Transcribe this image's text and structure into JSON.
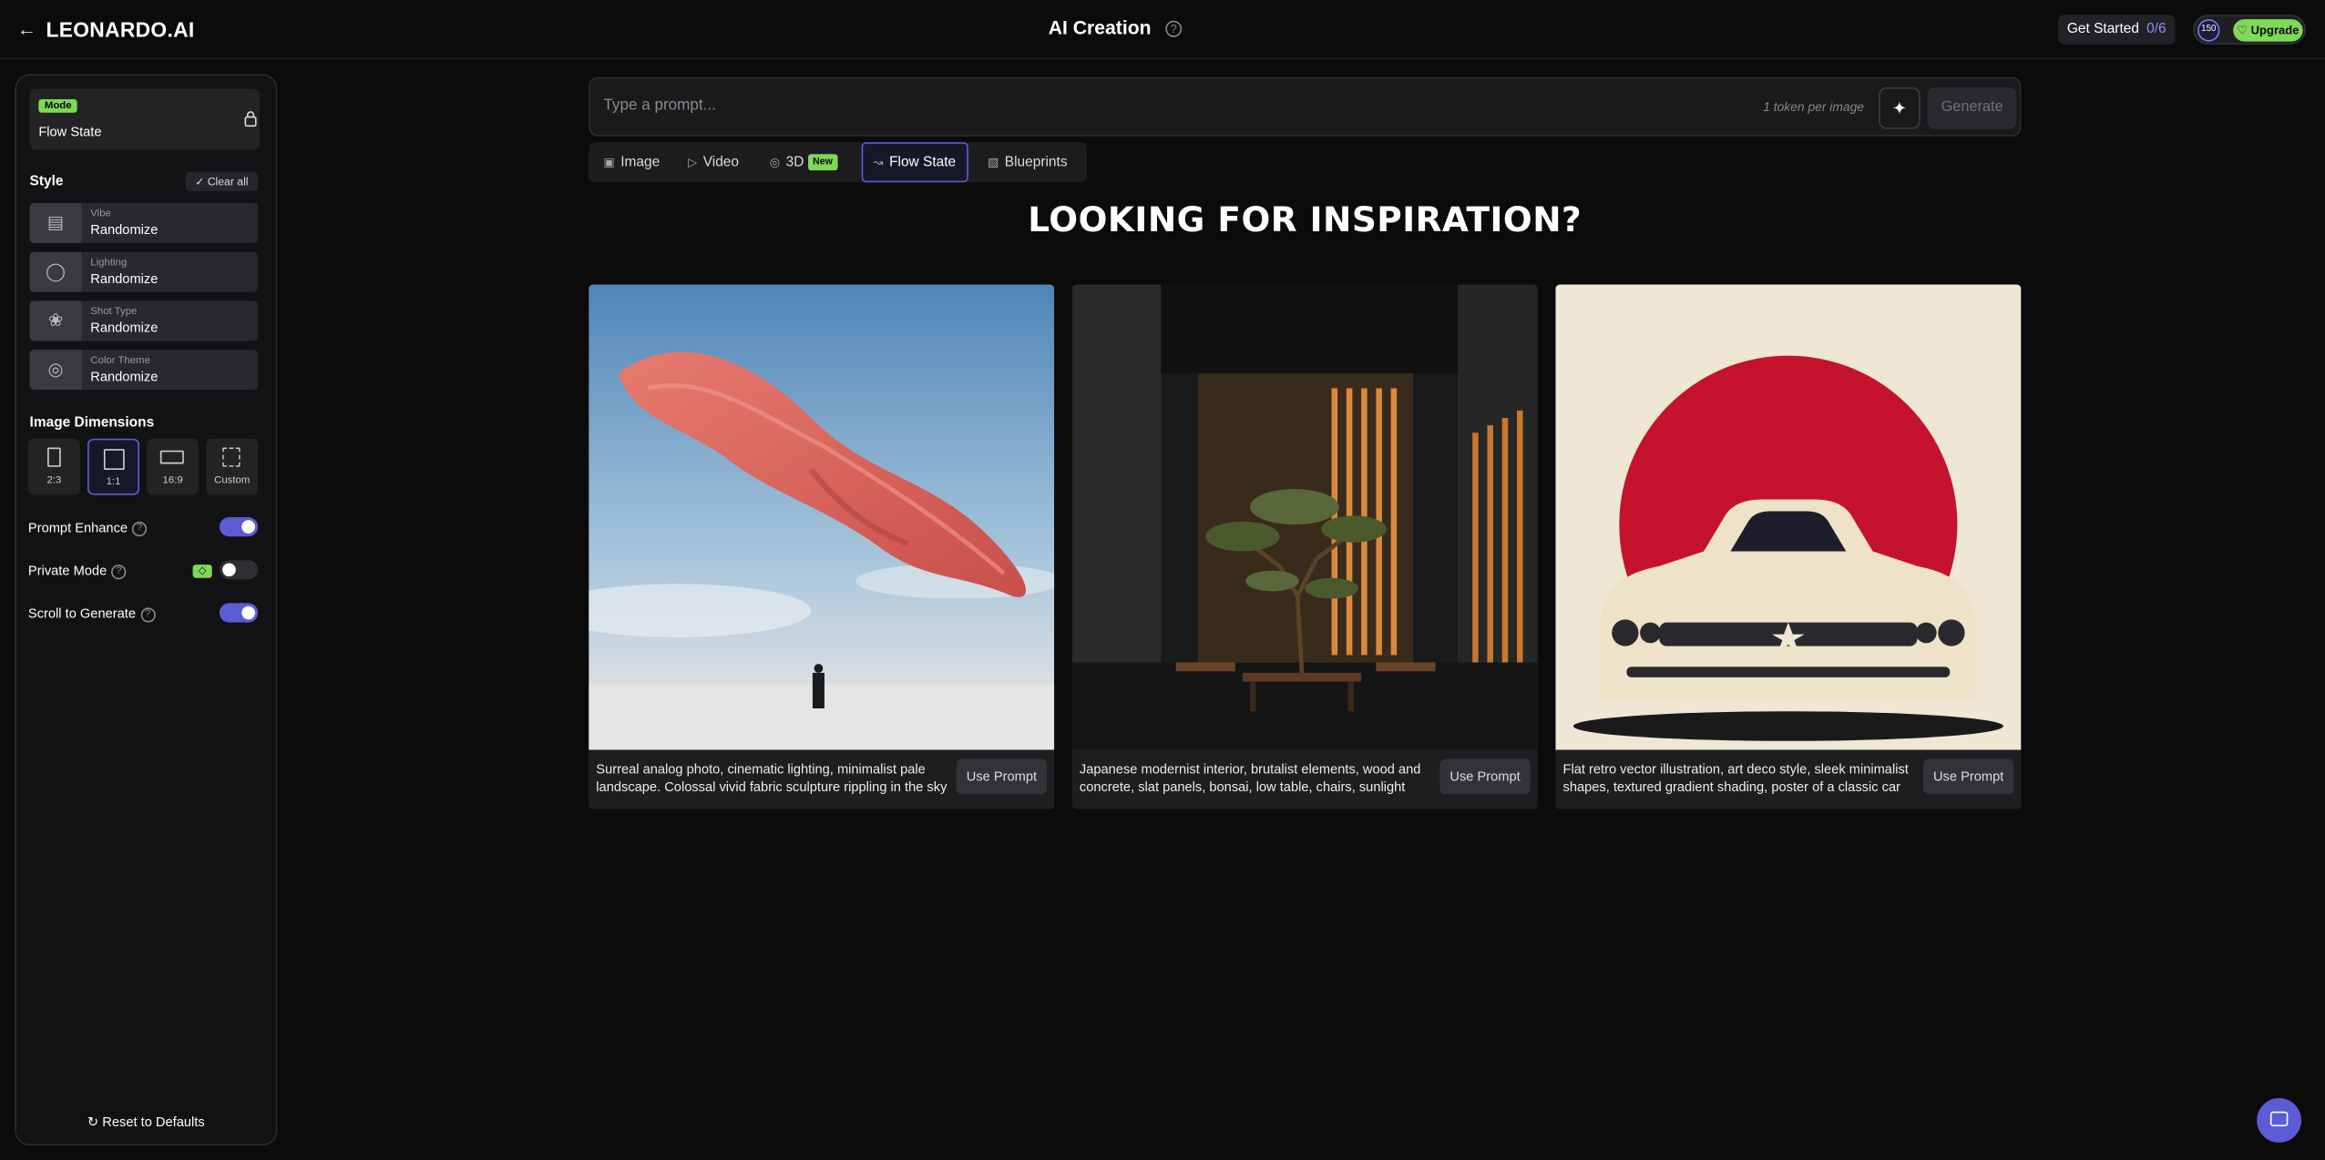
{
  "header": {
    "logo": "LEONARDO.AI",
    "title": "AI Creation",
    "get_started_label": "Get Started",
    "get_started_progress": "0/6",
    "token_count": "150",
    "upgrade_label": "Upgrade"
  },
  "sidebar": {
    "mode_badge": "Mode",
    "mode_value": "Flow State",
    "style_title": "Style",
    "clear_all": "Clear all",
    "style_rows": [
      {
        "label": "Vibe",
        "value": "Randomize",
        "icon": "vibe-icon"
      },
      {
        "label": "Lighting",
        "value": "Randomize",
        "icon": "lightbulb-icon"
      },
      {
        "label": "Shot Type",
        "value": "Randomize",
        "icon": "aperture-icon"
      },
      {
        "label": "Color Theme",
        "value": "Randomize",
        "icon": "color-circles-icon"
      }
    ],
    "dimensions_title": "Image Dimensions",
    "dimensions": [
      {
        "label": "2:3",
        "selected": false
      },
      {
        "label": "1:1",
        "selected": true
      },
      {
        "label": "16:9",
        "selected": false
      },
      {
        "label": "Custom",
        "selected": false
      }
    ],
    "toggles": [
      {
        "label": "Prompt Enhance",
        "on": true
      },
      {
        "label": "Private Mode",
        "on": false
      },
      {
        "label": "Scroll to Generate",
        "on": true
      }
    ],
    "reset_label": "Reset to Defaults"
  },
  "prompt": {
    "placeholder": "Type a prompt...",
    "token_note": "1 token per image",
    "generate_label": "Generate"
  },
  "tabs": [
    {
      "label": "Image",
      "icon": "image-icon"
    },
    {
      "label": "Video",
      "icon": "video-icon"
    },
    {
      "label": "3D",
      "icon": "globe-icon",
      "badge": "New"
    },
    {
      "label": "Flow State",
      "icon": "flow-icon",
      "active": true
    },
    {
      "label": "Blueprints",
      "icon": "blueprint-icon"
    }
  ],
  "inspiration": {
    "headline": "LOOKING FOR INSPIRATION?",
    "use_prompt_label": "Use Prompt",
    "cards": [
      {
        "caption": "Surreal analog photo, cinematic lighting, minimalist pale landscape. Colossal vivid fabric sculpture rippling in the sky"
      },
      {
        "caption": "Japanese modernist interior, brutalist elements, wood and concrete, slat panels, bonsai, low table, chairs, sunlight"
      },
      {
        "caption": "Flat retro vector illustration, art deco style, sleek minimalist shapes, textured gradient shading, poster of a classic car"
      }
    ]
  },
  "colors": {
    "accent": "#5b5cd6",
    "green": "#7ed957",
    "background": "#0b0b0c"
  }
}
